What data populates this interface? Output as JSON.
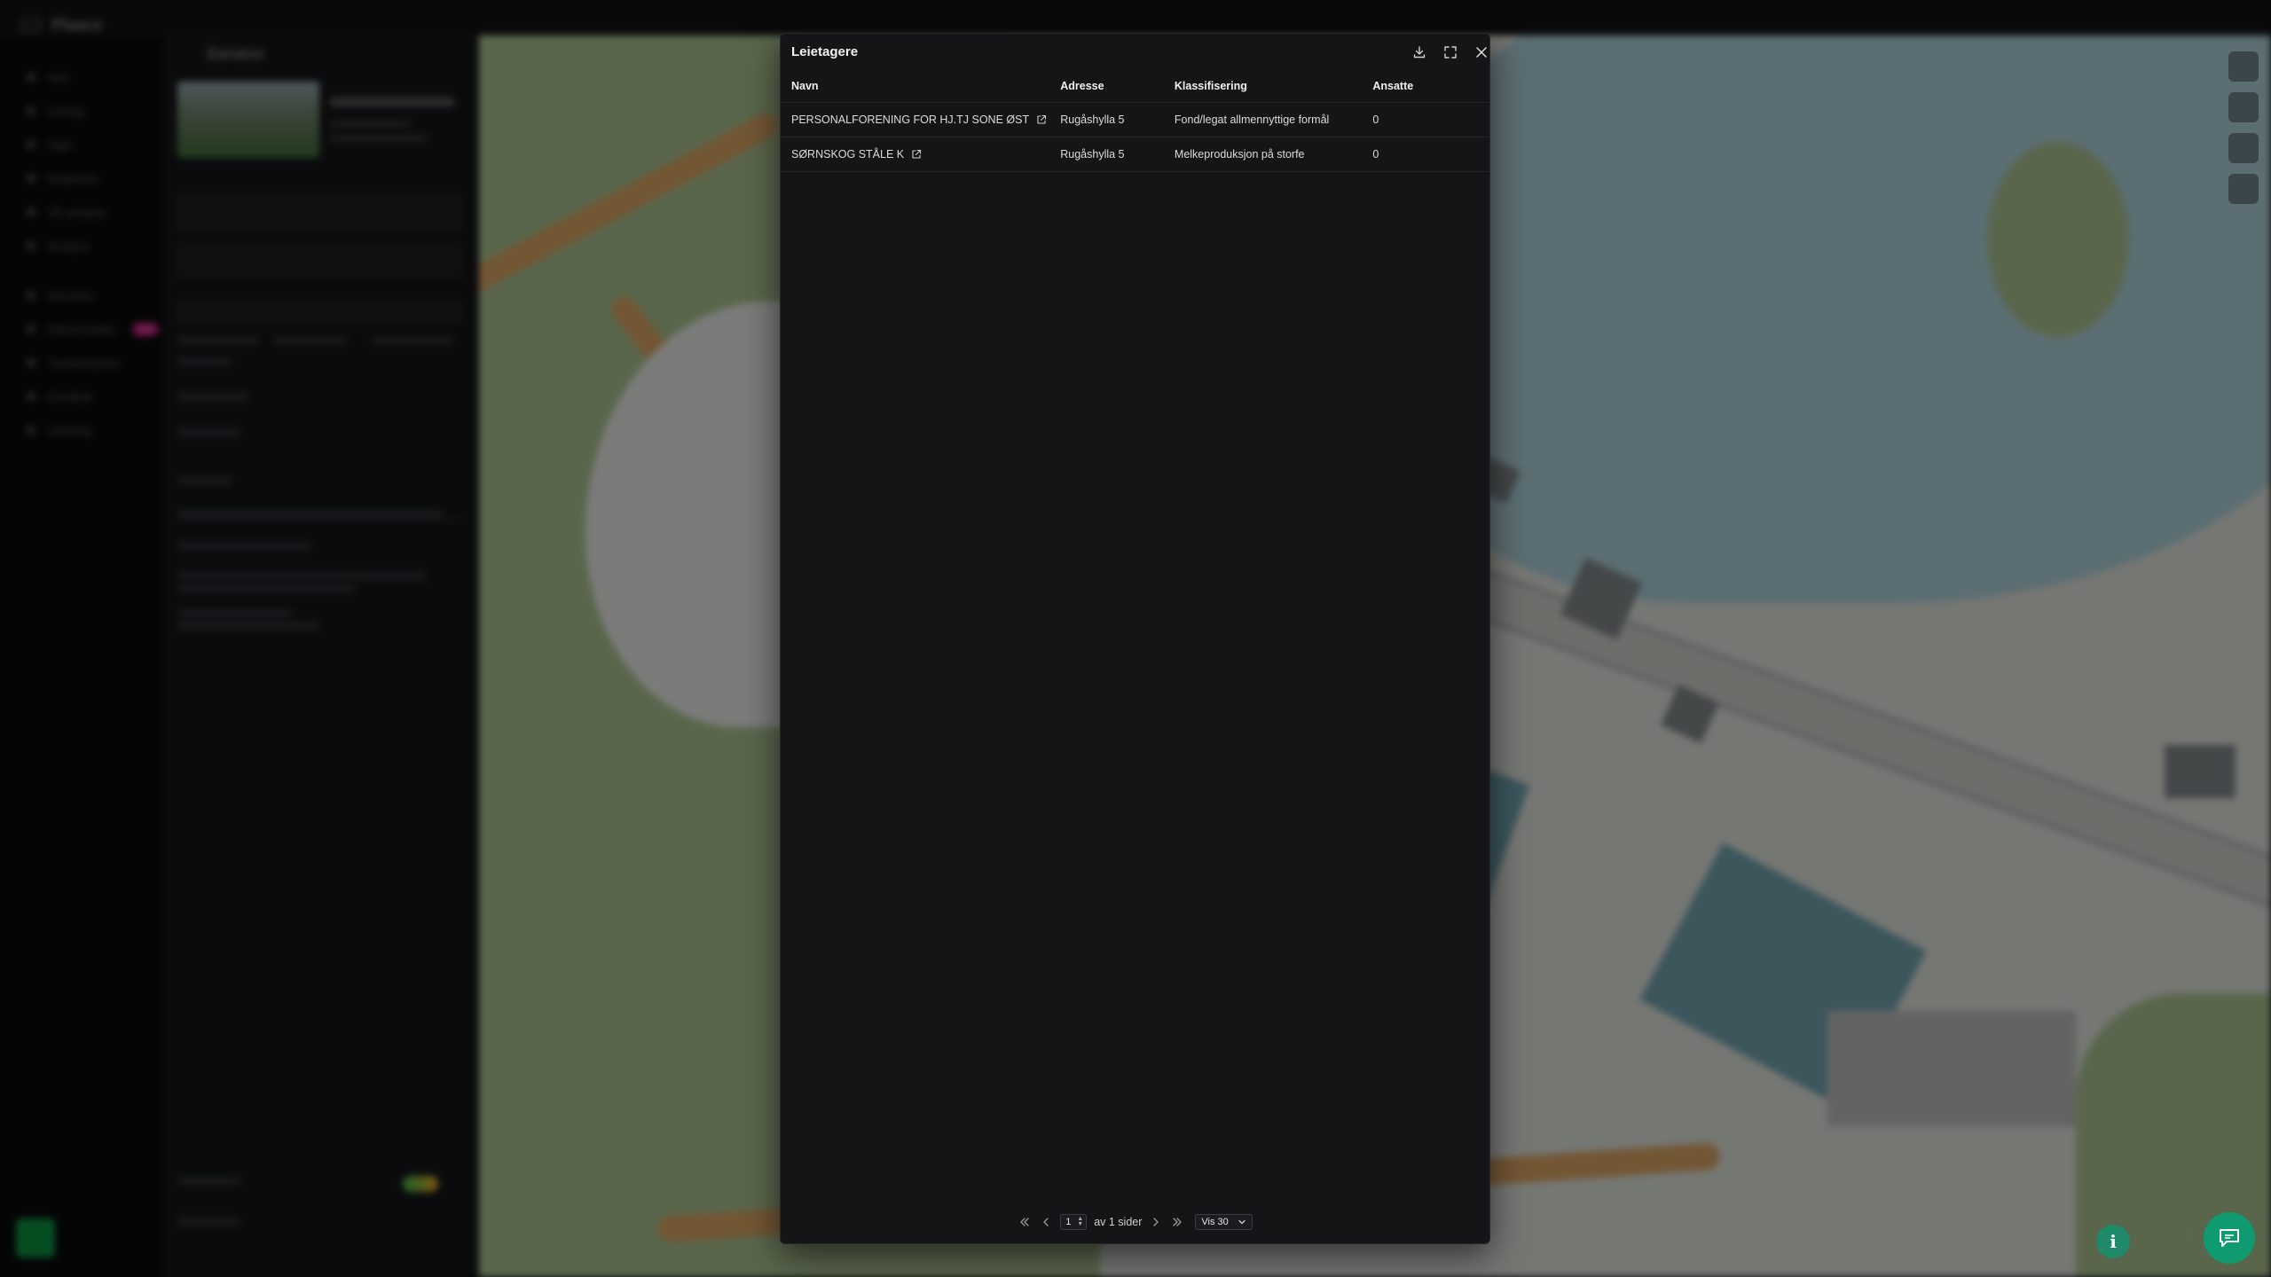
{
  "app": {
    "brand": "Plaace",
    "nav": [
      "Søk",
      "Kartlag",
      "Tegn",
      "Rapporter",
      "3D-analyse",
      "Analyse",
      "Eiendom",
      "Markedsdata",
      "Transaksjoner",
      "Områder",
      "Utvikling"
    ],
    "nav_badge": "NY",
    "panel_title": "Eiendom"
  },
  "modal": {
    "title": "Leietagere",
    "columns": {
      "name": "Navn",
      "address": "Adresse",
      "classification": "Klassifisering",
      "employees": "Ansatte"
    },
    "rows": [
      {
        "name": "PERSONALFORENING FOR HJ.TJ SONE ØST",
        "address": "Rugåshylla 5",
        "classification": "Fond/legat allmennyttige formål",
        "employees": "0"
      },
      {
        "name": "SØRNSKOG STÅLE K",
        "address": "Rugåshylla 5",
        "classification": "Melkeproduksjon på storfe",
        "employees": "0"
      }
    ],
    "pagination": {
      "page": "1",
      "of_label": "av 1 sider",
      "page_size": "Vis 30"
    }
  },
  "colors": {
    "modal_bg": "#141517",
    "accent_green": "#0f9a70",
    "badge_pink": "#c2227e"
  },
  "icons": [
    "download-icon",
    "expand-icon",
    "close-icon",
    "external-link-icon",
    "first-page-icon",
    "prev-page-icon",
    "next-page-icon",
    "last-page-icon",
    "chevron-down-icon",
    "info-icon",
    "chat-icon"
  ]
}
